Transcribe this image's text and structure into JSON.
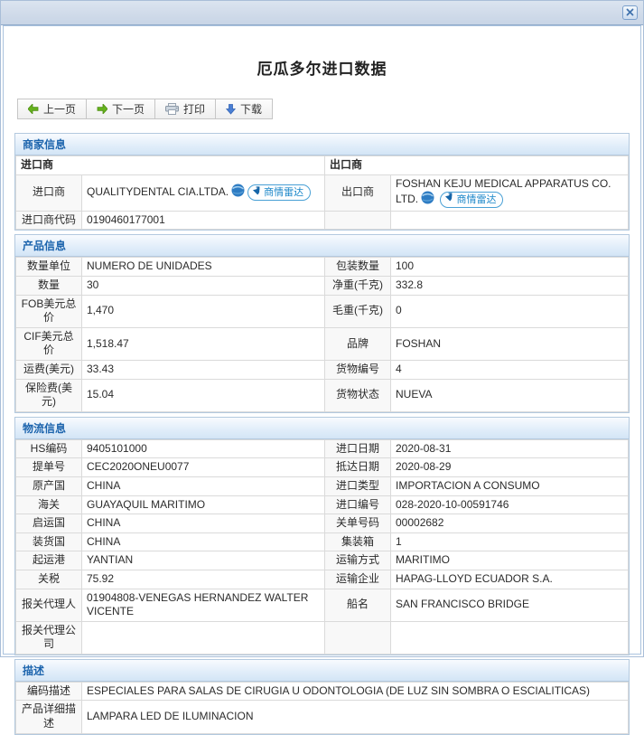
{
  "window": {
    "title": "厄瓜多尔进口数据"
  },
  "toolbar": {
    "prev_label": "上一页",
    "next_label": "下一页",
    "print_label": "打印",
    "download_label": "下载"
  },
  "badge": {
    "radar_label": "商情雷达"
  },
  "colors": {
    "titlebar": "#cfdae9",
    "section_header_text": "#1c64ad",
    "badge_blue": "#1b87c9",
    "arrow_green": "#66b31e",
    "arrow_blue": "#4a7fd4"
  },
  "sections": {
    "merchant": {
      "title": "商家信息",
      "importer_header": "进口商",
      "exporter_header": "出口商",
      "importer_label": "进口商",
      "importer_value": "QUALITYDENTAL CIA.LTDA.",
      "exporter_label": "出口商",
      "exporter_value": "FOSHAN KEJU MEDICAL APPARATUS CO. LTD.",
      "importer_code_label": "进口商代码",
      "importer_code_value": "0190460177001"
    },
    "product": {
      "title": "产品信息",
      "rows": [
        {
          "l1": "数量单位",
          "v1": "NUMERO DE UNIDADES",
          "l2": "包装数量",
          "v2": "100"
        },
        {
          "l1": "数量",
          "v1": "30",
          "l2": "净重(千克)",
          "v2": "332.8"
        },
        {
          "l1": "FOB美元总价",
          "v1": "1,470",
          "l2": "毛重(千克)",
          "v2": "0"
        },
        {
          "l1": "CIF美元总价",
          "v1": "1,518.47",
          "l2": "品牌",
          "v2": "FOSHAN"
        },
        {
          "l1": "运费(美元)",
          "v1": "33.43",
          "l2": "货物编号",
          "v2": "4"
        },
        {
          "l1": "保险费(美元)",
          "v1": "15.04",
          "l2": "货物状态",
          "v2": "NUEVA"
        }
      ]
    },
    "logistics": {
      "title": "物流信息",
      "rows": [
        {
          "l1": "HS编码",
          "v1": "9405101000",
          "l2": "进口日期",
          "v2": "2020-08-31"
        },
        {
          "l1": "提单号",
          "v1": "CEC2020ONEU0077",
          "l2": "抵达日期",
          "v2": "2020-08-29"
        },
        {
          "l1": "原产国",
          "v1": "CHINA",
          "l2": "进口类型",
          "v2": "IMPORTACION A CONSUMO"
        },
        {
          "l1": "海关",
          "v1": "GUAYAQUIL MARITIMO",
          "l2": "进口编号",
          "v2": "028-2020-10-00591746"
        },
        {
          "l1": "启运国",
          "v1": "CHINA",
          "l2": "关单号码",
          "v2": "00002682"
        },
        {
          "l1": "装货国",
          "v1": "CHINA",
          "l2": "集装箱",
          "v2": "1"
        },
        {
          "l1": "起运港",
          "v1": "YANTIAN",
          "l2": "运输方式",
          "v2": "MARITIMO"
        },
        {
          "l1": "关税",
          "v1": "75.92",
          "l2": "运输企业",
          "v2": "HAPAG-LLOYD ECUADOR S.A."
        },
        {
          "l1": "报关代理人",
          "v1": "01904808-VENEGAS HERNANDEZ WALTER VICENTE",
          "l2": "船名",
          "v2": "SAN FRANCISCO BRIDGE"
        },
        {
          "l1": "报关代理公司",
          "v1": "",
          "l2": "",
          "v2": ""
        }
      ]
    },
    "description": {
      "title": "描述",
      "rows": [
        {
          "label": "编码描述",
          "value": "ESPECIALES PARA SALAS DE CIRUGIA U ODONTOLOGIA (DE LUZ SIN SOMBRA O ESCIALITICAS)"
        },
        {
          "label": "产品详细描述",
          "value": "LAMPARA LED DE ILUMINACION"
        }
      ]
    }
  }
}
